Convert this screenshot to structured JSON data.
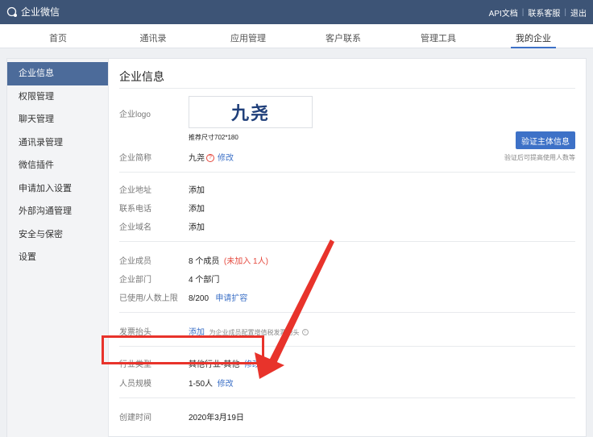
{
  "header": {
    "app_title": "企业微信",
    "links": [
      "API文档",
      "联系客服",
      "退出"
    ]
  },
  "nav": {
    "tabs": [
      {
        "label": "首页"
      },
      {
        "label": "通讯录"
      },
      {
        "label": "应用管理"
      },
      {
        "label": "客户联系"
      },
      {
        "label": "管理工具"
      },
      {
        "label": "我的企业"
      }
    ],
    "active": "我的企业"
  },
  "sidebar": {
    "items": [
      {
        "label": "企业信息"
      },
      {
        "label": "权限管理"
      },
      {
        "label": "聊天管理"
      },
      {
        "label": "通讯录管理"
      },
      {
        "label": "微信插件"
      },
      {
        "label": "申请加入设置"
      },
      {
        "label": "外部沟通管理"
      },
      {
        "label": "安全与保密"
      },
      {
        "label": "设置"
      }
    ],
    "active": "企业信息"
  },
  "main": {
    "title": "企业信息",
    "logo": {
      "label": "企业logo",
      "text": "九尧",
      "hint": "推荐尺寸702*180"
    },
    "verify": {
      "button": "验证主体信息",
      "note": "验证后可提高使用人数等"
    },
    "short_name": {
      "label": "企业简称",
      "value": "九尧",
      "help": "?",
      "edit": "修改"
    },
    "address": {
      "label": "企业地址",
      "action": "添加"
    },
    "phone": {
      "label": "联系电话",
      "action": "添加"
    },
    "domain": {
      "label": "企业域名",
      "action": "添加"
    },
    "members": {
      "label": "企业成员",
      "value": "8 个成员",
      "note": "(未加入 1人)"
    },
    "departments": {
      "label": "企业部门",
      "value": "4 个部门"
    },
    "usage": {
      "label": "已使用/人数上限",
      "value": "8/200",
      "action": "申请扩容"
    },
    "invoice": {
      "label": "发票抬头",
      "action": "添加",
      "desc": "为企业成员配置增值税发票抬头",
      "info": "i"
    },
    "industry": {
      "label": "行业类型",
      "value": "其他行业-其他",
      "edit": "修改"
    },
    "scale": {
      "label": "人员规模",
      "value": "1-50人",
      "edit": "修改"
    },
    "created": {
      "label": "创建时间",
      "value": "2020年3月19日"
    }
  },
  "colors": {
    "topbar": "#3d5476",
    "accent": "#3d71c7",
    "sidebar_active": "#4c6b9a",
    "annotation": "#e8332b"
  }
}
